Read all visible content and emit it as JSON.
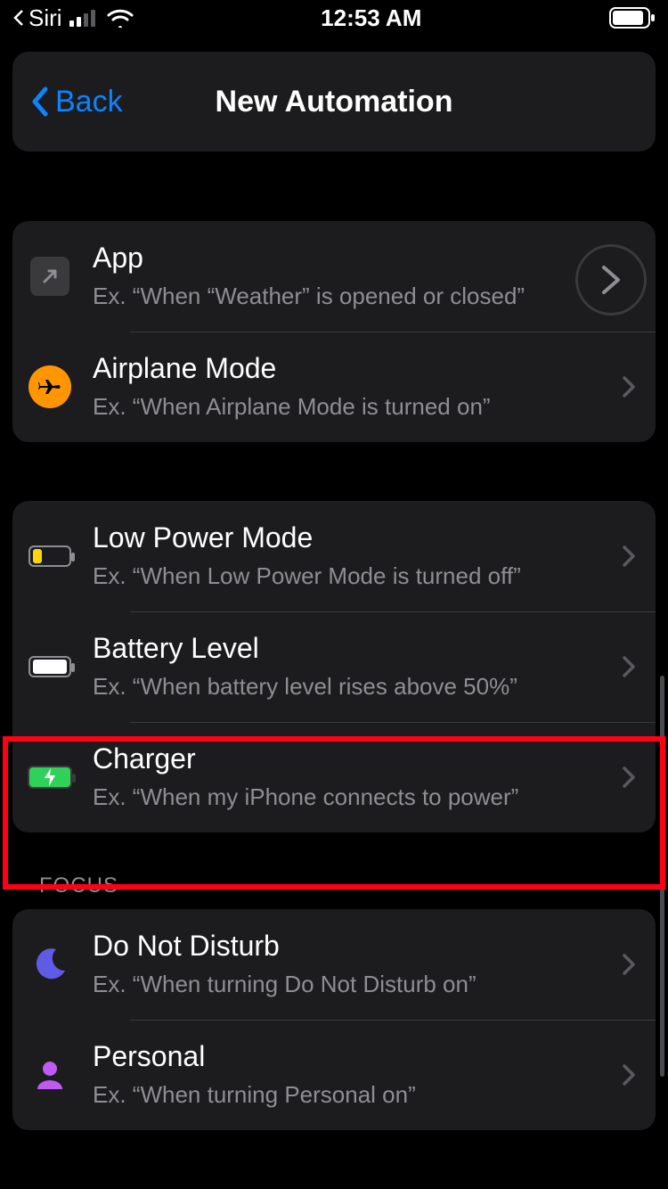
{
  "statusbar": {
    "breadcrumb_app": "Siri",
    "time": "12:53 AM"
  },
  "nav": {
    "back_label": "Back",
    "title": "New Automation"
  },
  "groups": [
    {
      "rows": [
        {
          "id": "app",
          "title": "App",
          "subtitle": "Ex. “When “Weather” is opened or closed”"
        },
        {
          "id": "airplane-mode",
          "title": "Airplane Mode",
          "subtitle": "Ex. “When Airplane Mode is turned on”"
        }
      ]
    },
    {
      "rows": [
        {
          "id": "low-power-mode",
          "title": "Low Power Mode",
          "subtitle": "Ex. “When Low Power Mode is turned off”"
        },
        {
          "id": "battery-level",
          "title": "Battery Level",
          "subtitle": "Ex. “When battery level rises above 50%”"
        },
        {
          "id": "charger",
          "title": "Charger",
          "subtitle": "Ex. “When my iPhone connects to power”"
        }
      ]
    }
  ],
  "focus_section": {
    "header": "FOCUS",
    "rows": [
      {
        "id": "do-not-disturb",
        "title": "Do Not Disturb",
        "subtitle": "Ex. “When turning Do Not Disturb on”"
      },
      {
        "id": "personal",
        "title": "Personal",
        "subtitle": "Ex. “When turning Personal on”"
      }
    ]
  },
  "highlight_row": "charger"
}
